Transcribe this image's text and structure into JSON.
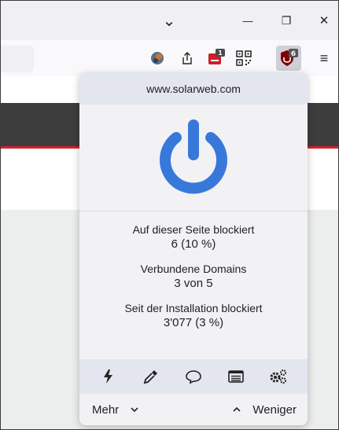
{
  "titlebar": {
    "tab_list_glyph": "⌄",
    "minimize_glyph": "—",
    "restore_glyph": "❐",
    "close_glyph": "✕"
  },
  "toolbar": {
    "extensions": [
      {
        "name": "profile-avatar-icon"
      },
      {
        "name": "share-icon"
      },
      {
        "name": "red-extension-icon",
        "badge": "1"
      },
      {
        "name": "qr-code-icon"
      },
      {
        "name": "ublock-origin-icon",
        "badge": "6"
      }
    ],
    "menu_glyph": "≡"
  },
  "popup": {
    "hostname": "www.solarweb.com",
    "stats": [
      {
        "label": "Auf dieser Seite blockiert",
        "value": "6 (10 %)"
      },
      {
        "label": "Verbundene Domains",
        "value": "3 von 5"
      },
      {
        "label": "Seit der Installation blockiert",
        "value": "3'077 (3 %)"
      }
    ],
    "tools": [
      "lightning-icon",
      "eyedropper-icon",
      "speech-bubble-icon",
      "logger-list-icon",
      "settings-gears-icon"
    ],
    "more_label": "Mehr",
    "less_label": "Weniger"
  },
  "colors": {
    "power_blue": "#3878db",
    "ublock_red": "#800000",
    "accent_red": "#d6202e",
    "badge_bg": "#555555"
  }
}
